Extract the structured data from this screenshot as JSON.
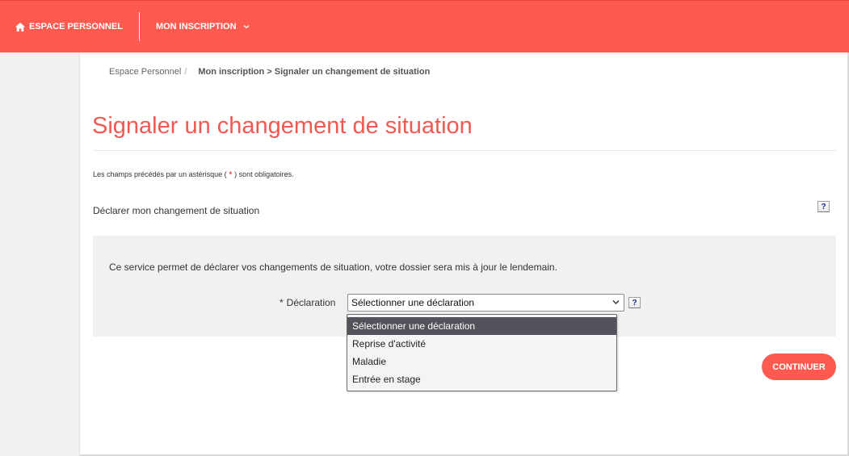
{
  "nav": {
    "home_label": "ESPACE PERSONNEL",
    "inscription_label": "MON INSCRIPTION",
    "accent_color": "#ff5a50",
    "home_icon": "home-icon",
    "menu_icon": "chevron-down-icon"
  },
  "breadcrumb": {
    "link": "Espace Personnel",
    "separator": "/",
    "current": "Mon inscription > Signaler un changement de situation"
  },
  "page": {
    "title": "Signaler un changement de situation",
    "title_color": "#ee5a52",
    "required_note_before": "Les champs précédés par un astérisque (",
    "required_note_asterisk": "*",
    "required_note_after": ") sont obligatoires.",
    "section_title": "Déclarer mon changement de situation",
    "help_label": "?"
  },
  "form": {
    "service_text": "Ce service permet de déclarer vos changements de situation, votre dossier sera mis à jour le lendemain.",
    "declaration_required_mark": "*",
    "declaration_label": "Déclaration",
    "declaration_selected": "Sélectionner une déclaration",
    "declaration_help": "?",
    "declaration_options": [
      "Sélectionner une déclaration",
      "Reprise d'activité",
      "Maladie",
      "Entrée en stage"
    ]
  },
  "actions": {
    "continue_label": "CONTINUER",
    "continue_color": "#ff5a50"
  }
}
